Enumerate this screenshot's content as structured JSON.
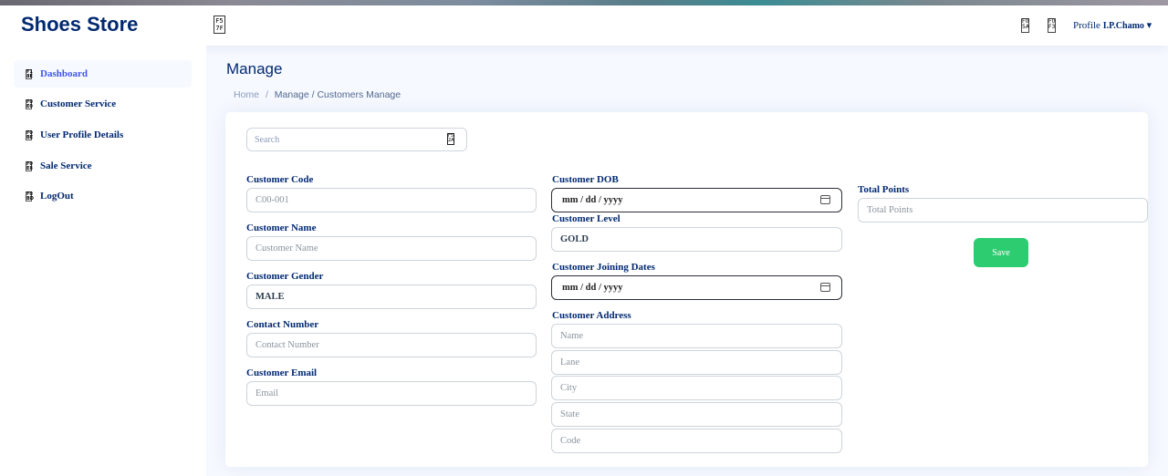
{
  "header": {
    "brand": "Shoes Store",
    "toggle_glyph": "F5 7F",
    "icon1_glyph": "F0 5A",
    "icon2_glyph": "F0 F3",
    "profile_label": "Profile",
    "user_name": "I.P.Chamo",
    "caret": "▾"
  },
  "sidebar": {
    "items": [
      {
        "label": "Dashboard",
        "glyph": "F1 8E"
      },
      {
        "label": "Customer Service",
        "glyph": "F0 E0"
      },
      {
        "label": "User Profile Details",
        "glyph": "F0 BE"
      },
      {
        "label": "Sale Service",
        "glyph": "F0 E8"
      },
      {
        "label": "LogOut",
        "glyph": "F0 BD"
      }
    ]
  },
  "page": {
    "title": "Manage",
    "breadcrumb": {
      "home": "Home",
      "sep": "/",
      "current": "Manage / Customers Manage"
    }
  },
  "search": {
    "placeholder": "Search",
    "glyph": "F5 2A"
  },
  "form": {
    "customer_code": {
      "label": "Customer Code",
      "value": "C00-001"
    },
    "customer_name": {
      "label": "Customer Name",
      "placeholder": "Customer Name"
    },
    "customer_gender": {
      "label": "Customer Gender",
      "value": "MALE"
    },
    "contact_number": {
      "label": "Contact Number",
      "placeholder": "Contact Number"
    },
    "customer_email": {
      "label": "Customer Email",
      "placeholder": "Email"
    },
    "customer_dob": {
      "label": "Customer DOB",
      "value": "mm / dd / yyyy"
    },
    "customer_level": {
      "label": "Customer Level",
      "value": "GOLD"
    },
    "joining_dates": {
      "label": "Customer Joining Dates",
      "value": "mm / dd / yyyy"
    },
    "customer_address": {
      "label": "Customer Address",
      "name_placeholder": "Name",
      "lane_placeholder": "Lane",
      "city_placeholder": "City",
      "state_placeholder": "State",
      "code_placeholder": "Code"
    },
    "total_points": {
      "label": "Total Points",
      "placeholder": "Total Points"
    },
    "save_label": "Save"
  },
  "colors": {
    "primary": "#012970",
    "accent": "#4154f1",
    "save": "#2ecc71"
  }
}
